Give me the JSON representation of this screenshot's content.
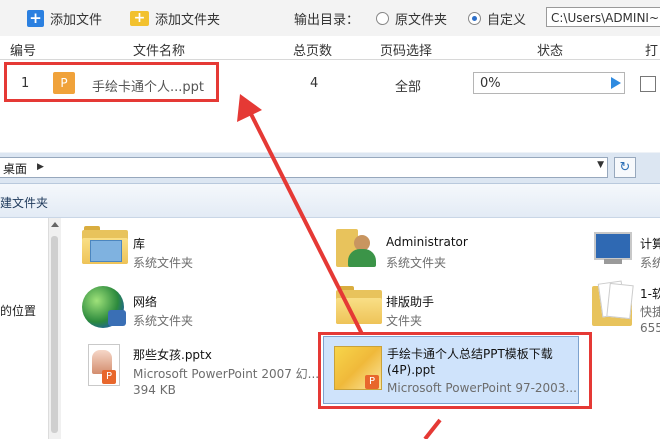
{
  "toolbar": {
    "add_file": "添加文件",
    "add_folder": "添加文件夹",
    "output_dir_label": "输出目录：",
    "option_original": "原文件夹",
    "option_custom": "自定义",
    "custom_selected": true,
    "path_value": "C:\\Users\\ADMINI~"
  },
  "table": {
    "headers": [
      "编号",
      "文件名称",
      "总页数",
      "页码选择",
      "状态",
      "打"
    ],
    "row": {
      "index": "1",
      "icon_letter": "P",
      "filename": "手绘卡通个人...ppt",
      "pages": "4",
      "page_selection": "全部",
      "progress_text": "0%",
      "progress_fraction": 0
    }
  },
  "explorer": {
    "address": "桌面",
    "command_bar": "建文件夹",
    "nav_label": "的位置",
    "items": [
      {
        "name": "库",
        "sub": "系统文件夹",
        "icon": "library-folder-icon"
      },
      {
        "name": "Administrator",
        "sub": "系统文件夹",
        "icon": "user-folder-icon"
      },
      {
        "name": "计算",
        "sub": "系统",
        "icon": "computer-icon"
      },
      {
        "name": "网络",
        "sub": "系统文件夹",
        "icon": "network-globe-icon"
      },
      {
        "name": "排版助手",
        "sub": "文件夹",
        "icon": "folder-icon"
      },
      {
        "name": "1-软",
        "sub": "快捷",
        "sub2": "655",
        "icon": "documents-folder-icon"
      },
      {
        "name": "那些女孩.pptx",
        "sub": "Microsoft PowerPoint 2007 幻...",
        "sub2": "394 KB",
        "icon": "pptx-file-icon"
      }
    ],
    "selected_item": {
      "name_line1": "手绘卡通个人总结PPT模板下载",
      "name_line2": "(4P).ppt",
      "sub": "Microsoft PowerPoint 97-2003...",
      "badge_letter": "P"
    }
  },
  "annotation": {
    "arrow_color": "#e53935",
    "highlight_color": "#e53935"
  }
}
